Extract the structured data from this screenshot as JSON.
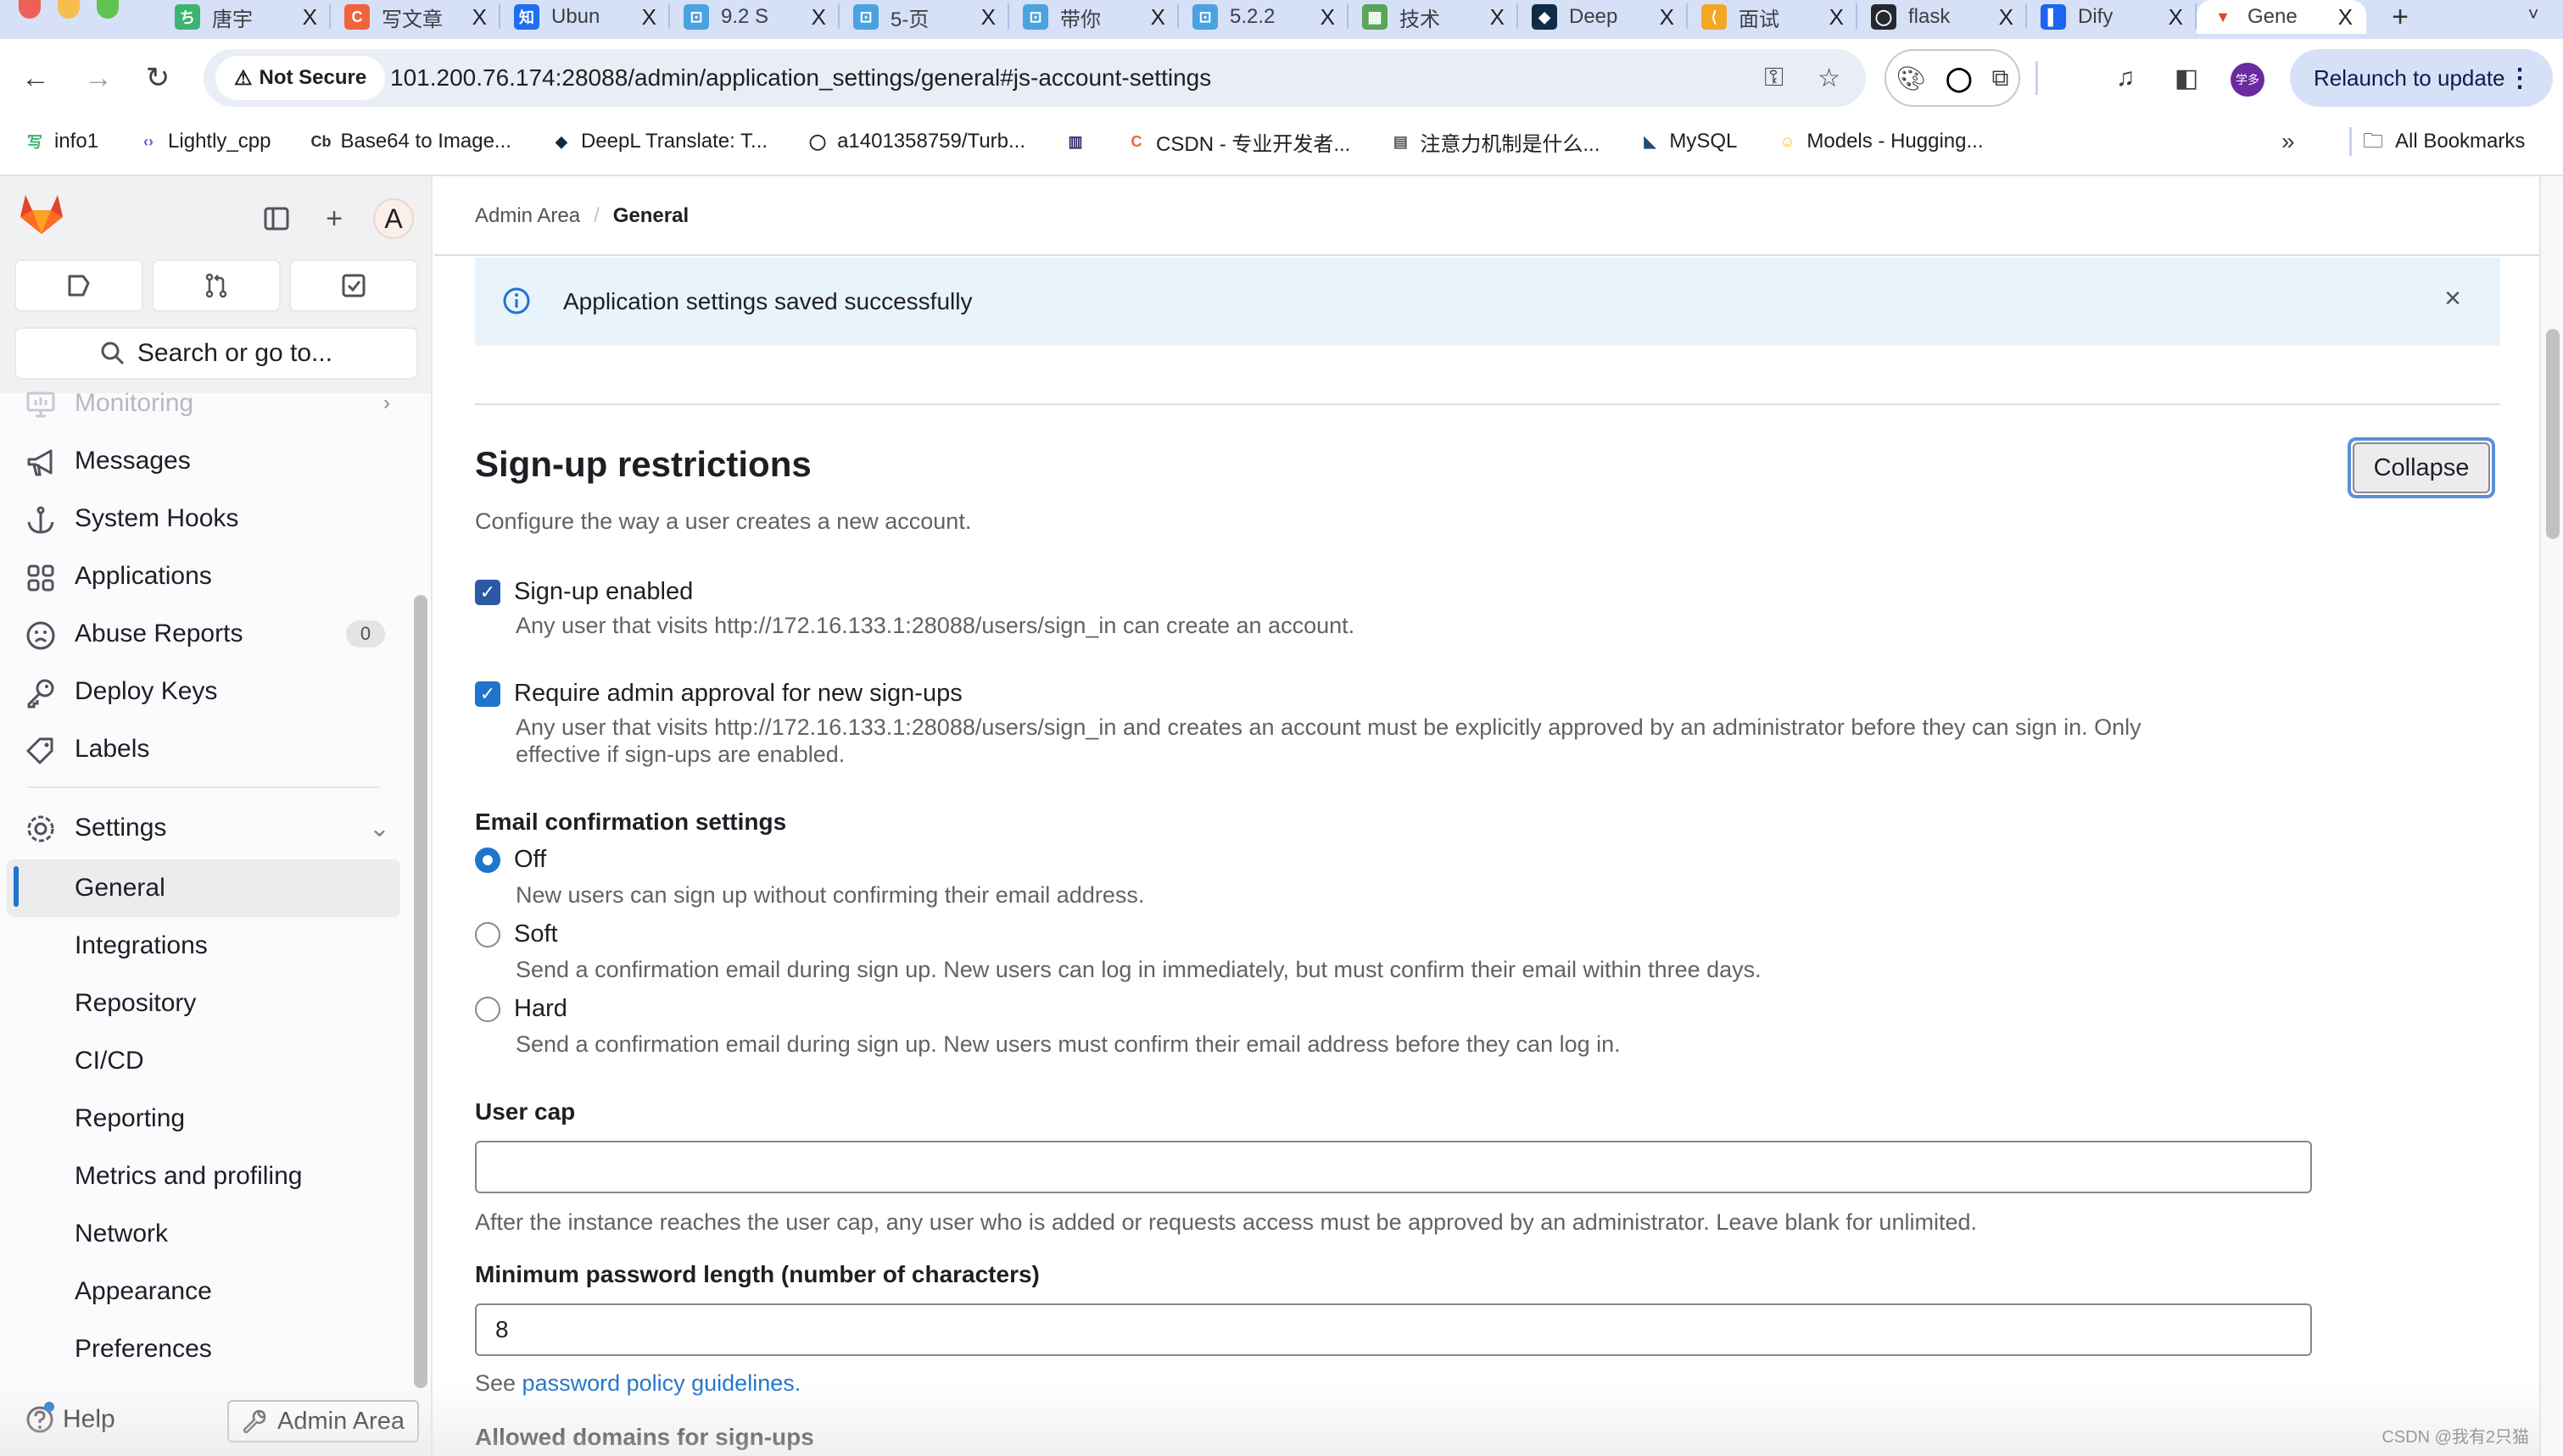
{
  "browser": {
    "tabs": [
      {
        "title": "唐宇",
        "favicon_color": "#3cb371",
        "favicon_glyph": "ち"
      },
      {
        "title": "写文章",
        "favicon_color": "#f0643c",
        "favicon_glyph": "C"
      },
      {
        "title": "Ubun",
        "favicon_color": "#1e6ff0",
        "favicon_glyph": "知"
      },
      {
        "title": "9.2 S",
        "favicon_color": "#4aa3df",
        "favicon_glyph": "⊡"
      },
      {
        "title": "5-页",
        "favicon_color": "#4aa3df",
        "favicon_glyph": "⊡"
      },
      {
        "title": "带你",
        "favicon_color": "#4aa3df",
        "favicon_glyph": "⊡"
      },
      {
        "title": "5.2.2",
        "favicon_color": "#4aa3df",
        "favicon_glyph": "⊡"
      },
      {
        "title": "技术",
        "favicon_color": "#5aa55a",
        "favicon_glyph": "▦"
      },
      {
        "title": "Deep",
        "favicon_color": "#0f2b46",
        "favicon_glyph": "◆"
      },
      {
        "title": "面试",
        "favicon_color": "#f5a623",
        "favicon_glyph": "⟨"
      },
      {
        "title": "flask",
        "favicon_color": "#24292f",
        "favicon_glyph": "◯"
      },
      {
        "title": "Dify",
        "favicon_color": "#1c64f2",
        "favicon_glyph": "▌"
      },
      {
        "title": "Gene",
        "favicon_color": "#e24329",
        "favicon_glyph": "▼",
        "active": true
      }
    ],
    "tab_close_glyph": "X",
    "new_tab_glyph": "+",
    "tab_menu_glyph": "˅",
    "back_icon": "←",
    "forward_icon": "→",
    "reload_icon": "↻",
    "security_warning": "Not Secure",
    "url": "101.200.76.174:28088/admin/application_settings/general#js-account-settings",
    "relaunch_label": "Relaunch to update",
    "profile_initials": "学多",
    "bookmarks": [
      {
        "label": "info1",
        "icon": "写",
        "color": "#3cb371"
      },
      {
        "label": "Lightly_cpp",
        "icon": "‹›",
        "color": "#6a5acd"
      },
      {
        "label": "Base64 to Image...",
        "icon": "Cb",
        "color": "#333333"
      },
      {
        "label": "DeepL Translate: T...",
        "icon": "◆",
        "color": "#0f2b46"
      },
      {
        "label": "a1401358759/Turb...",
        "icon": "◯",
        "color": "#24292f"
      },
      {
        "label": "",
        "icon": "▥",
        "color": "#2a2a6a"
      },
      {
        "label": "CSDN - 专业开发者...",
        "icon": "C",
        "color": "#f0643c"
      },
      {
        "label": "注意力机制是什么...",
        "icon": "▤",
        "color": "#555555"
      },
      {
        "label": "MySQL",
        "icon": "◣",
        "color": "#1e4f7a"
      },
      {
        "label": "Models - Hugging...",
        "icon": "☺",
        "color": "#f5c518"
      }
    ],
    "bookmarks_overflow": "»",
    "all_bookmarks": "All Bookmarks"
  },
  "sidebar": {
    "avatar_initial": "A",
    "search_label": "Search or go to...",
    "items": [
      {
        "label": "Monitoring",
        "icon": "monitor",
        "faded": true,
        "chevron": "›"
      },
      {
        "label": "Messages",
        "icon": "bullhorn"
      },
      {
        "label": "System Hooks",
        "icon": "anchor"
      },
      {
        "label": "Applications",
        "icon": "applications"
      },
      {
        "label": "Abuse Reports",
        "icon": "sad-face",
        "badge": "0"
      },
      {
        "label": "Deploy Keys",
        "icon": "key"
      },
      {
        "label": "Labels",
        "icon": "label"
      }
    ],
    "settings": {
      "label": "Settings",
      "chevron": "⌄",
      "subitems": [
        {
          "label": "General",
          "active": true
        },
        {
          "label": "Integrations"
        },
        {
          "label": "Repository"
        },
        {
          "label": "CI/CD"
        },
        {
          "label": "Reporting"
        },
        {
          "label": "Metrics and profiling"
        },
        {
          "label": "Network"
        },
        {
          "label": "Appearance"
        },
        {
          "label": "Preferences"
        }
      ]
    },
    "help_label": "Help",
    "admin_area_label": "Admin Area"
  },
  "breadcrumb": {
    "root": "Admin Area",
    "separator": "/",
    "current": "General"
  },
  "alert": {
    "message": "Application settings saved successfully",
    "close_glyph": "×"
  },
  "section": {
    "title": "Sign-up restrictions",
    "description": "Configure the way a user creates a new account.",
    "collapse_label": "Collapse",
    "signup_enabled": {
      "label": "Sign-up enabled",
      "checked": true,
      "help": "Any user that visits http://172.16.133.1:28088/users/sign_in can create an account."
    },
    "admin_approval": {
      "label": "Require admin approval for new sign-ups",
      "checked": true,
      "help_line1": "Any user that visits http://172.16.133.1:28088/users/sign_in and creates an account must be explicitly approved by an administrator before they can sign in. Only",
      "help_line2": "effective if sign-ups are enabled."
    },
    "email_confirmation": {
      "label": "Email confirmation settings",
      "selected": "Off",
      "options": [
        {
          "label": "Off",
          "help": "New users can sign up without confirming their email address."
        },
        {
          "label": "Soft",
          "help": "Send a confirmation email during sign up. New users can log in immediately, but must confirm their email within three days."
        },
        {
          "label": "Hard",
          "help": "Send a confirmation email during sign up. New users must confirm their email address before they can log in."
        }
      ]
    },
    "user_cap": {
      "label": "User cap",
      "value": "",
      "help": "After the instance reaches the user cap, any user who is added or requests access must be approved by an administrator. Leave blank for unlimited."
    },
    "min_password": {
      "label": "Minimum password length (number of characters)",
      "value": "8",
      "help_prefix": "See ",
      "help_link": "password policy guidelines",
      "help_suffix": "."
    },
    "allowed_domains": {
      "label": "Allowed domains for sign-ups"
    }
  },
  "watermark": "CSDN @我有2只猫"
}
